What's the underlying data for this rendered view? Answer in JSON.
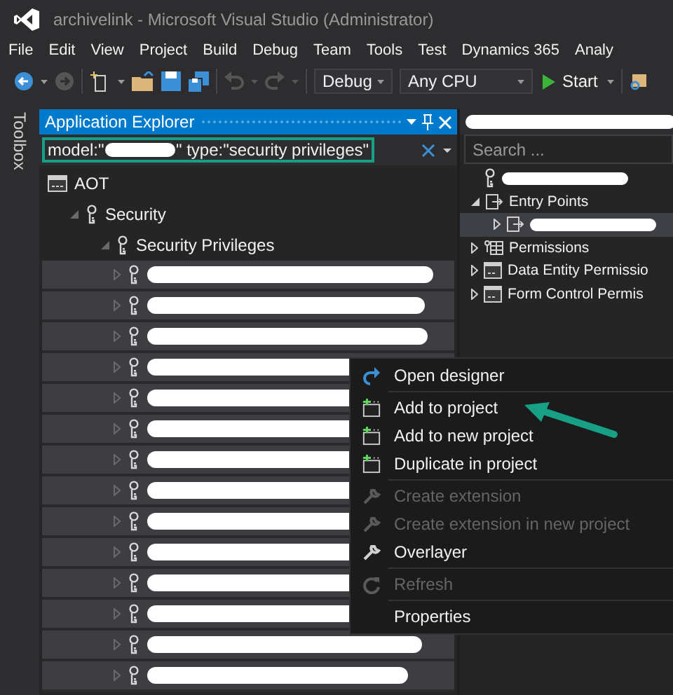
{
  "window": {
    "title": "archivelink - Microsoft Visual Studio (Administrator)"
  },
  "menu": [
    "File",
    "Edit",
    "View",
    "Project",
    "Build",
    "Debug",
    "Team",
    "Tools",
    "Test",
    "Dynamics 365",
    "Analy"
  ],
  "toolbar": {
    "configuration": "Debug",
    "platform": "Any CPU",
    "start": "Start"
  },
  "side_tab": "Toolbox",
  "explorer": {
    "title": "Application Explorer",
    "search": {
      "value_start": "model:\"",
      "value_end": "\" type:\"security privileges\""
    },
    "tree": [
      {
        "label": "AOT",
        "kind": "aot",
        "children": [
          {
            "label": "Security",
            "kind": "key",
            "expanded": true,
            "children": [
              {
                "label": "Security Privileges",
                "kind": "key",
                "expanded": true,
                "children": [
                  {
                    "kind": "key",
                    "expanded": false
                  },
                  {
                    "kind": "key",
                    "expanded": false
                  },
                  {
                    "kind": "key",
                    "expanded": false
                  },
                  {
                    "kind": "key",
                    "expanded": false
                  },
                  {
                    "kind": "key",
                    "expanded": false
                  },
                  {
                    "kind": "key",
                    "expanded": false
                  },
                  {
                    "kind": "key",
                    "expanded": false
                  },
                  {
                    "kind": "key",
                    "expanded": false
                  },
                  {
                    "kind": "key",
                    "expanded": false
                  },
                  {
                    "kind": "key",
                    "expanded": false
                  },
                  {
                    "kind": "key",
                    "expanded": false
                  },
                  {
                    "kind": "key",
                    "expanded": false
                  },
                  {
                    "kind": "key",
                    "expanded": false
                  },
                  {
                    "kind": "key",
                    "expanded": false
                  }
                ]
              }
            ]
          }
        ]
      }
    ]
  },
  "designer": {
    "search": {
      "placeholder": "Search ..."
    },
    "tree": [
      {
        "kind": "key"
      },
      {
        "label": "Entry Points",
        "kind": "entry",
        "expanded": true,
        "children": [
          {
            "kind": "entry",
            "expanded": false,
            "selected": true
          }
        ]
      },
      {
        "label": "Permissions",
        "kind": "grid",
        "expanded": false
      },
      {
        "label": "Data Entity Permissio",
        "kind": "form",
        "expanded": false
      },
      {
        "label": "Form Control Permis",
        "kind": "form",
        "expanded": false
      }
    ]
  },
  "context_menu": [
    {
      "label": "Open designer",
      "kind": "designer",
      "disabled": false,
      "separator_after": true
    },
    {
      "label": "Add to project",
      "kind": "add",
      "disabled": false,
      "separator_after": false
    },
    {
      "label": "Add to new project",
      "kind": "add",
      "disabled": false,
      "separator_after": false
    },
    {
      "label": "Duplicate in project",
      "kind": "add",
      "disabled": false,
      "separator_after": true
    },
    {
      "label": "Create extension",
      "kind": "extension",
      "disabled": true,
      "separator_after": false
    },
    {
      "label": "Create extension in new project",
      "kind": "extension",
      "disabled": true,
      "separator_after": false
    },
    {
      "label": "Overlayer",
      "kind": "wrench",
      "disabled": false,
      "separator_after": true
    },
    {
      "label": "Refresh",
      "kind": "refresh",
      "disabled": true,
      "separator_after": true
    },
    {
      "label": "Properties",
      "kind": "none",
      "disabled": false,
      "separator_after": false
    }
  ]
}
